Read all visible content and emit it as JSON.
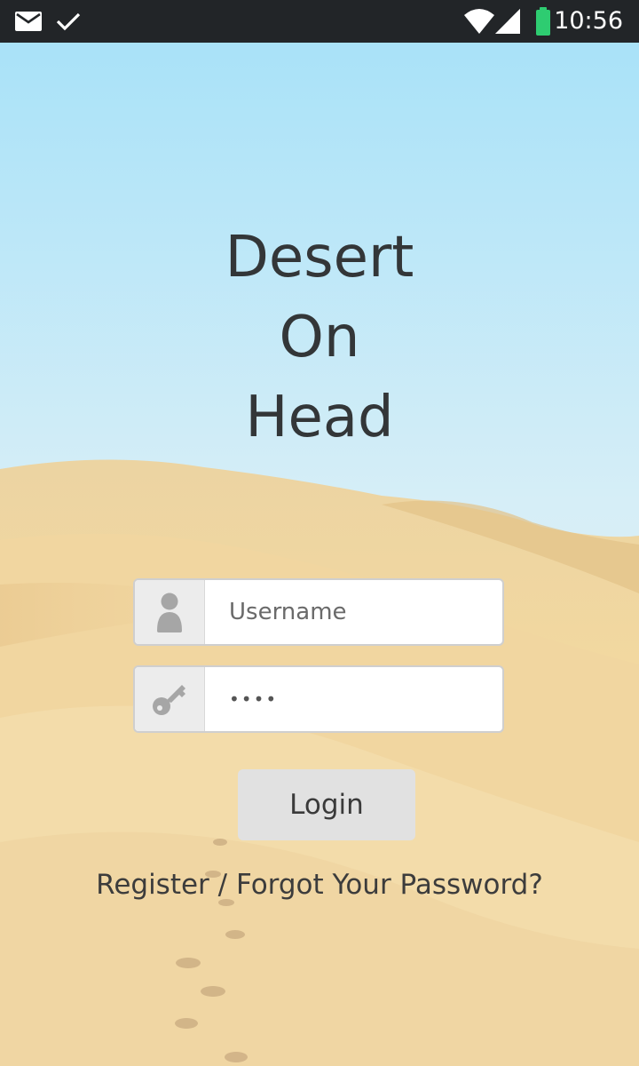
{
  "status_bar": {
    "time": "10:56",
    "icons": [
      "mail-icon",
      "check-icon",
      "wifi-icon",
      "cellular-signal-icon",
      "battery-icon"
    ],
    "battery_color": "#2ecc71"
  },
  "app": {
    "title_lines": [
      "Desert",
      "On",
      "Head"
    ]
  },
  "form": {
    "username": {
      "placeholder": "Username",
      "value": "",
      "icon": "user-icon"
    },
    "password": {
      "value": "1234",
      "icon": "key-icon"
    },
    "login_label": "Login"
  },
  "links": {
    "register": "Register",
    "separator": " / ",
    "forgot": "Forgot Your Password?"
  },
  "colors": {
    "status_bar_bg": "#222528",
    "sky_top": "#a9e2f8",
    "sand": "#f0d59c",
    "text": "#333638",
    "button_bg": "#e1e1e1"
  }
}
